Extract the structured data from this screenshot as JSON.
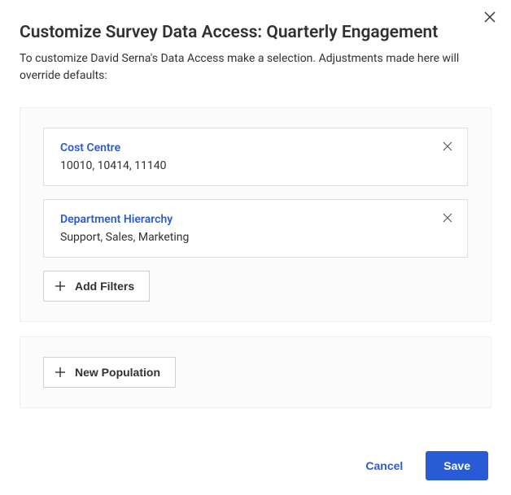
{
  "title": "Customize Survey Data Access: Quarterly Engagement",
  "subtitle": "To customize David Serna's Data Access make a selection. Adjustments made here will override defaults:",
  "panels": {
    "filters": [
      {
        "title": "Cost Centre",
        "values": "10010, 10414, 11140"
      },
      {
        "title": "Department Hierarchy",
        "values": "Support, Sales, Marketing"
      }
    ]
  },
  "buttons": {
    "add_filters": "Add Filters",
    "new_population": "New Population",
    "cancel": "Cancel",
    "save": "Save"
  }
}
